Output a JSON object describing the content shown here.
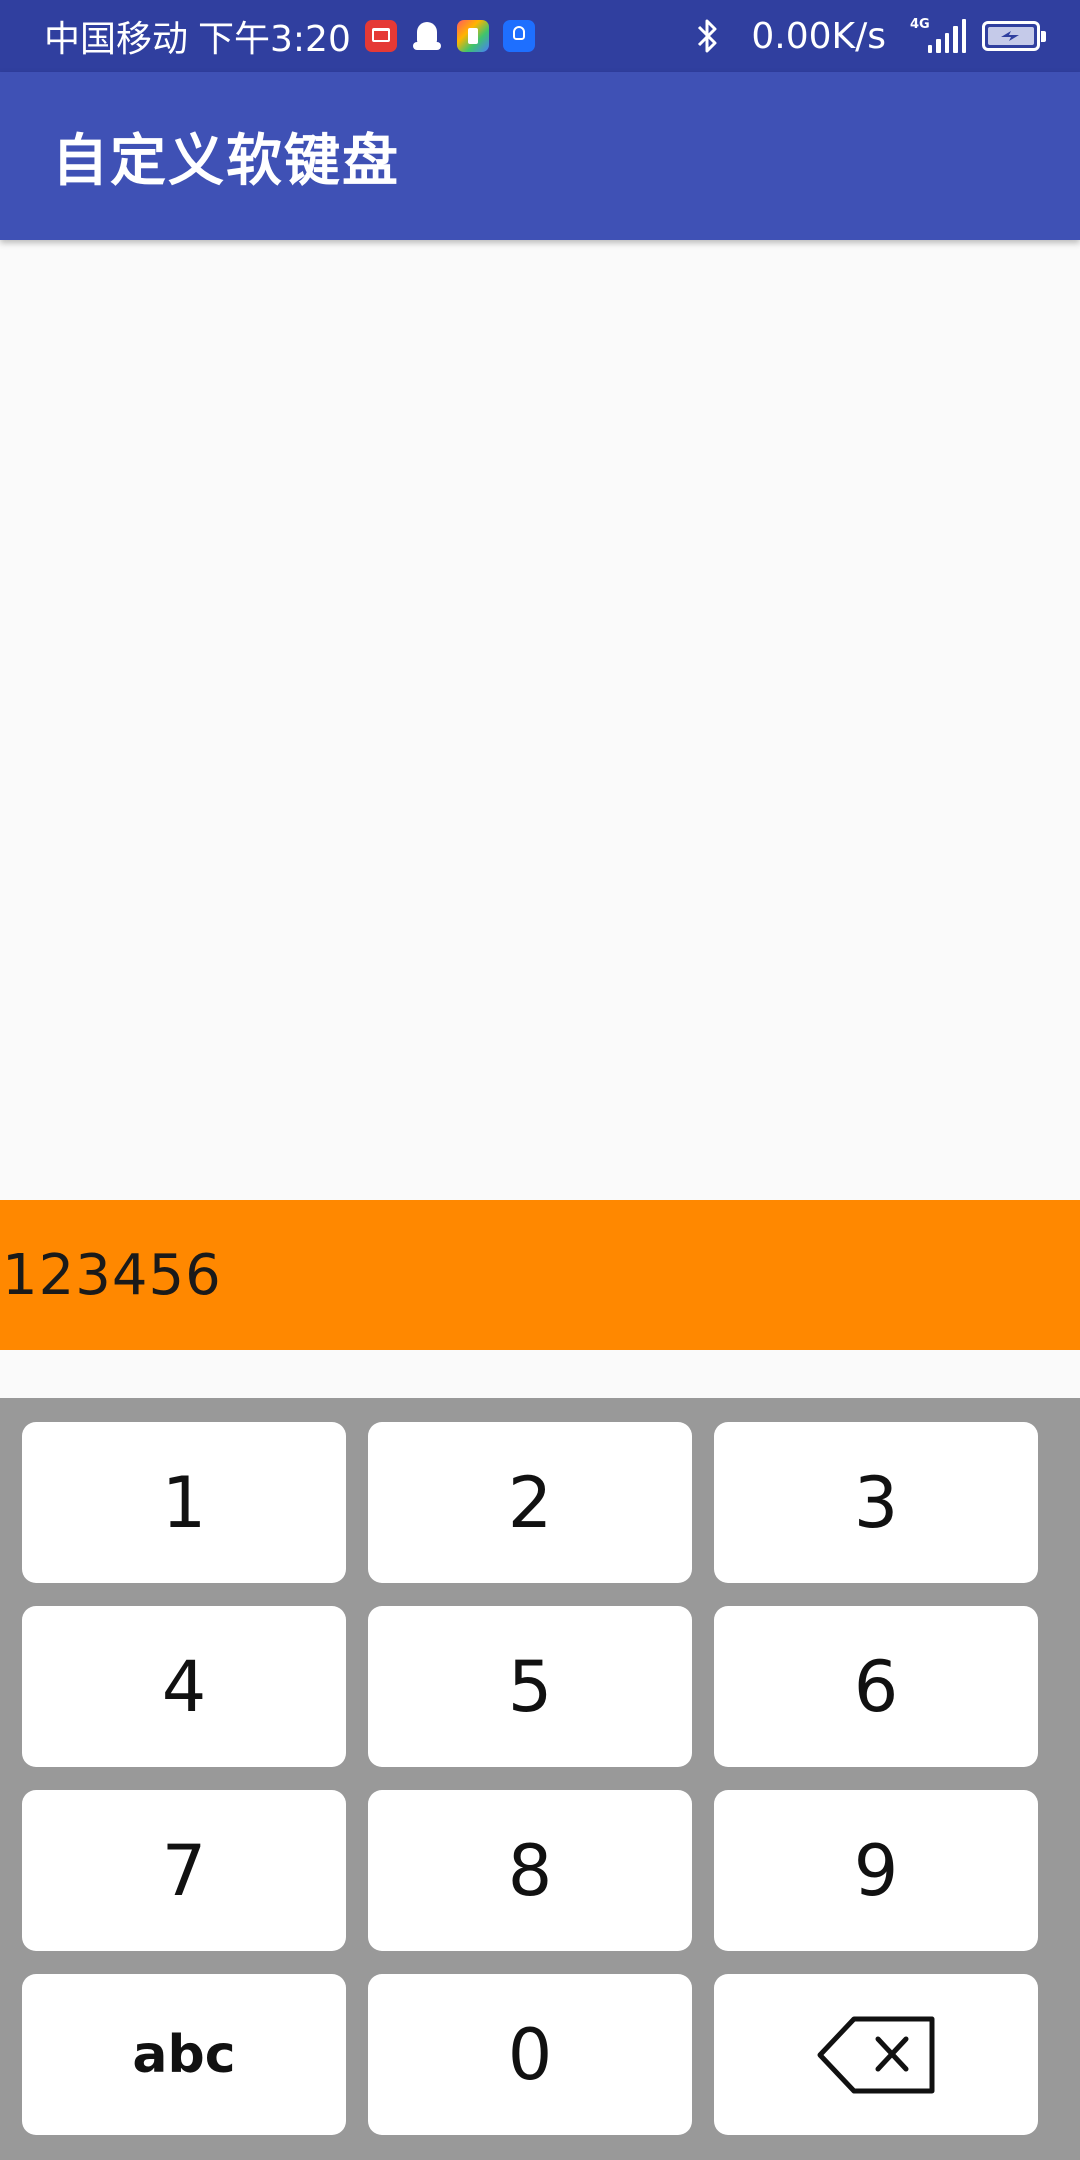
{
  "status_bar": {
    "carrier": "中国移动",
    "time": "下午3:20",
    "net_speed": "0.00K/s",
    "network_type": "4G",
    "notification_icons": [
      "book-icon",
      "qq-icon",
      "app-icon",
      "bulb-icon"
    ],
    "background_color": "#303f9f"
  },
  "app_bar": {
    "title": "自定义软键盘",
    "background_color": "#3f51b5"
  },
  "input": {
    "value": "123456",
    "background_color": "#ff8800"
  },
  "keyboard": {
    "background_color": "#999999",
    "keys": {
      "k1": "1",
      "k2": "2",
      "k3": "3",
      "k4": "4",
      "k5": "5",
      "k6": "6",
      "k7": "7",
      "k8": "8",
      "k9": "9",
      "abc": "abc",
      "k0": "0",
      "delete_icon": "backspace-icon"
    }
  }
}
